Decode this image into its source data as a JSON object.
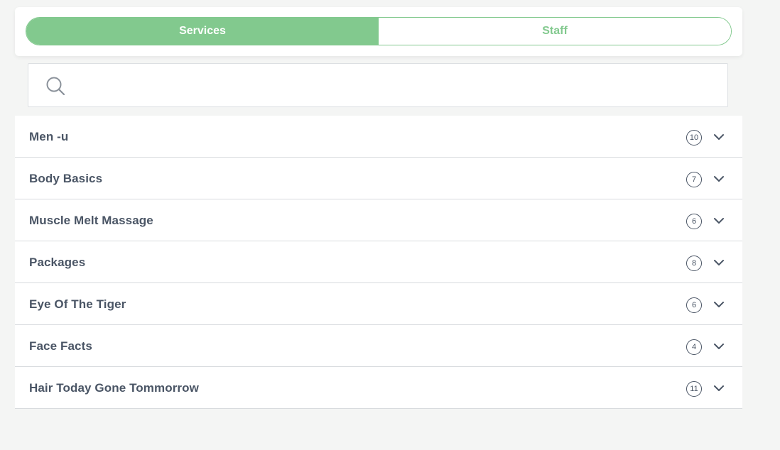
{
  "tabs": [
    {
      "label": "Services",
      "active": true
    },
    {
      "label": "Staff",
      "active": false
    }
  ],
  "search": {
    "value": "",
    "placeholder": ""
  },
  "categories": [
    {
      "name": "Men -u",
      "count": "10"
    },
    {
      "name": "Body Basics",
      "count": "7"
    },
    {
      "name": "Muscle Melt Massage",
      "count": "6"
    },
    {
      "name": "Packages",
      "count": "8"
    },
    {
      "name": "Eye Of The Tiger",
      "count": "6"
    },
    {
      "name": "Face Facts",
      "count": "4"
    },
    {
      "name": "Hair Today Gone Tommorrow",
      "count": "11"
    }
  ],
  "colors": {
    "accent": "#82c98e",
    "text": "#4a5565",
    "background": "#f4f5f4",
    "divider": "#d8dbde"
  },
  "icons": {
    "search": "search-icon",
    "expand": "chevron-down-icon"
  }
}
